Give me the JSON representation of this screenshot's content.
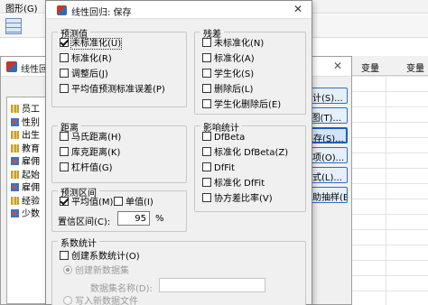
{
  "background_app": {
    "menu_graphs": "图形(G)",
    "var_column_header_1": "变量",
    "var_column_header_2": "变量"
  },
  "regression_dialog": {
    "title": "线性回归",
    "close_glyph": "✕",
    "variables": [
      {
        "label": "员工",
        "icon": "scale-icon"
      },
      {
        "label": "性别",
        "icon": "nominal-icon"
      },
      {
        "label": "出生",
        "icon": "scale-icon"
      },
      {
        "label": "教育",
        "icon": "scale-icon"
      },
      {
        "label": "雇佣",
        "icon": "nominal-icon"
      },
      {
        "label": "起始",
        "icon": "scale-icon"
      },
      {
        "label": "雇佣",
        "icon": "nominal-icon"
      },
      {
        "label": "经验",
        "icon": "scale-icon"
      },
      {
        "label": "少数",
        "icon": "nominal-icon"
      }
    ],
    "side_buttons": [
      {
        "label": "统计(S)...",
        "focused": false
      },
      {
        "label": "图(T)...",
        "focused": false
      },
      {
        "label": "保存(S)...",
        "focused": true
      },
      {
        "label": "选项(O)...",
        "focused": false
      },
      {
        "label": "样式(L)...",
        "focused": false
      },
      {
        "label": "自助抽样(B)...",
        "focused": false
      }
    ]
  },
  "save_dialog": {
    "title": "线性回归: 保存",
    "close_glyph": "✕",
    "predicted": {
      "legend": "预测值",
      "options": [
        {
          "label": "未标准化(U)",
          "checked": true,
          "focused": true
        },
        {
          "label": "标准化(R)",
          "checked": false
        },
        {
          "label": "调整后(J)",
          "checked": false
        },
        {
          "label": "平均值预测标准误差(P)",
          "checked": false
        }
      ]
    },
    "residuals": {
      "legend": "残差",
      "options": [
        {
          "label": "未标准化(N)",
          "checked": false
        },
        {
          "label": "标准化(A)",
          "checked": false
        },
        {
          "label": "学生化(S)",
          "checked": false
        },
        {
          "label": "删除后(L)",
          "checked": false
        },
        {
          "label": "学生化删除后(E)",
          "checked": false
        }
      ]
    },
    "distances": {
      "legend": "距离",
      "options": [
        {
          "label": "马氏距离(H)",
          "checked": false
        },
        {
          "label": "库克距离(K)",
          "checked": false
        },
        {
          "label": "杠杆值(G)",
          "checked": false
        }
      ]
    },
    "influence": {
      "legend": "影响统计",
      "options": [
        {
          "label": "DfBeta",
          "checked": false
        },
        {
          "label": "标准化 DfBeta(Z)",
          "checked": false
        },
        {
          "label": "DfFit",
          "checked": false
        },
        {
          "label": "标准化 DfFit",
          "checked": false
        },
        {
          "label": "协方差比率(V)",
          "checked": false
        }
      ]
    },
    "prediction_intervals": {
      "legend": "预测区间",
      "mean_label": "平均值(M)",
      "mean_checked": true,
      "individual_label": "单值(I)",
      "individual_checked": false,
      "confidence_label": "置信区间(C):",
      "confidence_value": "95",
      "percent_sign": "%"
    },
    "coefficient_stats": {
      "legend": "系数统计",
      "create_label": "创建系数统计(O)",
      "create_checked": false,
      "new_dataset_label": "创建新数据集",
      "dataset_name_label": "数据集名称(D):",
      "dataset_name_value": "",
      "write_new_file_label": "写入新数据文件"
    }
  }
}
